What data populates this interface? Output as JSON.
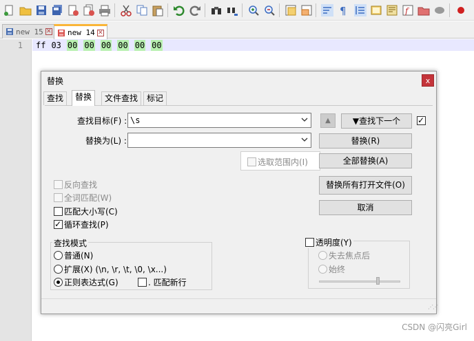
{
  "toolbar": {
    "icons": [
      "new-file-icon",
      "open-file-icon",
      "save-icon",
      "save-all-icon",
      "close-icon",
      "close-all-icon",
      "print-icon",
      "cut-icon",
      "copy-icon",
      "paste-icon",
      "undo-icon",
      "redo-icon",
      "find-icon",
      "replace-icon",
      "zoom-in-icon",
      "zoom-out-icon",
      "sync-vertical-icon",
      "sync-horizontal-icon",
      "word-wrap-icon",
      "show-all-chars-icon",
      "indent-guide-icon",
      "language-icon",
      "doc-map-icon",
      "function-list-icon",
      "folder-workspace-icon",
      "monitor-icon",
      "record-macro-icon",
      "stop-record-icon"
    ]
  },
  "tabs": [
    {
      "label": "new 15",
      "active": false
    },
    {
      "label": "new 14",
      "active": true
    }
  ],
  "editor": {
    "line_number": "1",
    "tokens": [
      {
        "text": "ff",
        "hl": false
      },
      {
        "text": "03",
        "hl": false
      },
      {
        "text": "00",
        "hl": true
      },
      {
        "text": "00",
        "hl": true
      },
      {
        "text": "00",
        "hl": true
      },
      {
        "text": "00",
        "hl": true
      },
      {
        "text": "00",
        "hl": true
      },
      {
        "text": "00",
        "hl": true
      }
    ]
  },
  "dialog": {
    "title": "替换",
    "close": "x",
    "tabs": [
      "查找",
      "替换",
      "文件查找",
      "标记"
    ],
    "active_tab": "替换",
    "find_label": "查找目标(F) :",
    "find_value": "\\s",
    "replace_label": "替换为(L) :",
    "replace_value": "",
    "up_arrow": "▲",
    "find_next": "▼查找下一个",
    "find_next_checked": true,
    "replace_btn": "替换(R)",
    "replace_all_btn": "全部替换(A)",
    "replace_all_open_btn": "替换所有打开文件(O)",
    "cancel_btn": "取消",
    "in_selection": "选取范围内(I)",
    "options": [
      {
        "label": "反向查找",
        "checked": false,
        "disabled": true
      },
      {
        "label": "全词匹配(W)",
        "checked": false,
        "disabled": true
      },
      {
        "label": "匹配大小写(C)",
        "checked": false,
        "disabled": false
      },
      {
        "label": "循环查找(P)",
        "checked": true,
        "disabled": false
      }
    ],
    "search_mode": {
      "title": "查找模式",
      "normal": "普通(N)",
      "extended": "扩展(X) (\\n, \\r, \\t, \\0, \\x...)",
      "regex": "正则表达式(G)",
      "selected": "regex",
      "dot_newline": ". 匹配新行",
      "dot_newline_checked": false
    },
    "transparency": {
      "title": "透明度(Y)",
      "checked": false,
      "on_lose_focus": "失去焦点后",
      "always": "始终",
      "level": 0.7
    }
  },
  "watermark": "CSDN @闪亮Girl"
}
